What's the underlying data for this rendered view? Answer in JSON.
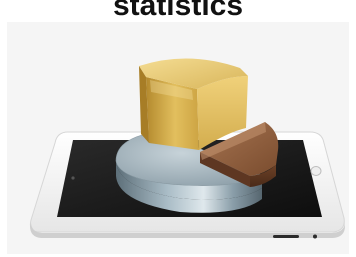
{
  "title": "statistics",
  "image": {
    "subject": "tablet-with-3d-pie-chart",
    "colors": {
      "panel_bg": "#f5f5f5",
      "tablet_frame": "#f7f7f7",
      "screen": "#1a1a1a",
      "slice_gold": "#d9b24f",
      "slice_steel": "#9fb0ba",
      "slice_brown": "#8a5a3a"
    }
  }
}
